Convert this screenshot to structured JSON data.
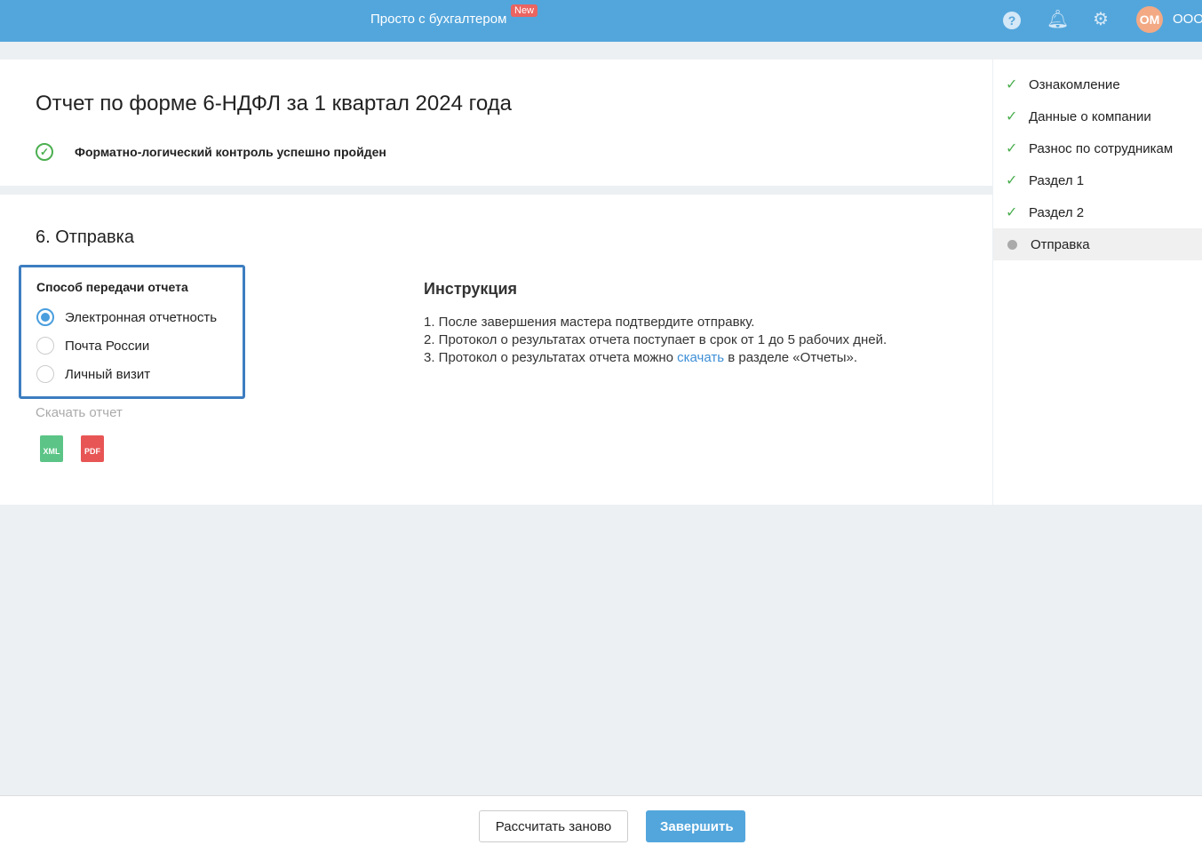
{
  "header": {
    "brand": "Просто с бухгалтером",
    "badge": "New",
    "avatar": "ОМ",
    "org": "ООО"
  },
  "title": "Отчет по форме 6-НДФЛ за 1 квартал 2024 года",
  "check_status": "Форматно-логический контроль успешно пройден",
  "section_title": "6. Отправка",
  "method": {
    "title": "Способ передачи отчета",
    "options": [
      "Электронная отчетность",
      "Почта России",
      "Личный визит"
    ],
    "selected": 0
  },
  "download": {
    "label": "Скачать отчет",
    "xml": "XML",
    "pdf": "PDF"
  },
  "instructions": {
    "title": "Инструкция",
    "line1": "1. После завершения мастера подтвердите отправку.",
    "line2": "2. Протокол о результатах отчета поступает в срок от 1 до 5 рабочих дней.",
    "line3_before": "3. Протокол о результатах отчета можно ",
    "line3_link": "скачать",
    "line3_after": " в разделе «Отчеты»."
  },
  "steps": [
    "Ознакомление",
    "Данные о компании",
    "Разнос по сотрудникам",
    "Раздел 1",
    "Раздел 2",
    "Отправка"
  ],
  "footer": {
    "recalc": "Рассчитать заново",
    "finish": "Завершить"
  },
  "colors": {
    "header": "#53a6dc",
    "accent": "#4a9ede",
    "success": "#4caf50"
  }
}
